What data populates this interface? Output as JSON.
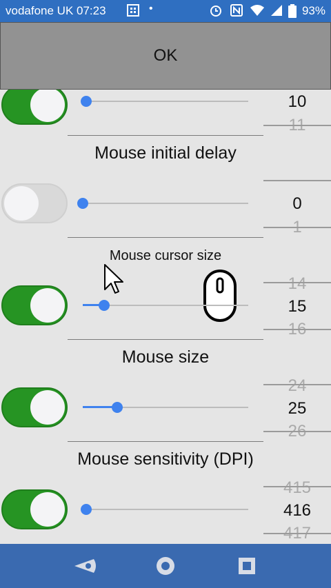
{
  "status": {
    "carrier_time": "vodafone UK  07:23",
    "battery": "93%",
    "left_icons": [
      "grid-icon",
      "dot-icon"
    ],
    "right_icons": [
      "alarm-icon",
      "nfc-icon",
      "wifi-icon",
      "signal-icon",
      "battery-icon"
    ]
  },
  "ok_label": "OK",
  "rows": [
    {
      "toggle": "on",
      "slider_value": 0.02,
      "picker": {
        "selected": "10",
        "next": "11"
      }
    },
    {
      "label": "Mouse initial delay",
      "toggle": "off",
      "slider_value": 0.0,
      "picker": {
        "selected": "0",
        "next": "1"
      }
    },
    {
      "label": "Mouse cursor size",
      "toggle": "on",
      "slider_value": 0.13,
      "picker": {
        "prev": "14",
        "selected": "15",
        "next": "16"
      }
    },
    {
      "label": "Mouse size",
      "toggle": "on",
      "slider_value": 0.21,
      "picker": {
        "prev": "24",
        "selected": "25",
        "next": "26"
      }
    },
    {
      "label": "Mouse sensitivity (DPI)",
      "toggle": "on",
      "slider_value": 0.02,
      "picker": {
        "prev": "415",
        "selected": "416",
        "next": "417"
      }
    }
  ],
  "colors": {
    "toggle_on": "#269423",
    "slider": "#3f82ee",
    "status_bar": "#2f6fc1",
    "nav_bar": "#3a6ab0"
  },
  "nav": [
    "back-icon",
    "home-icon",
    "recents-icon"
  ]
}
